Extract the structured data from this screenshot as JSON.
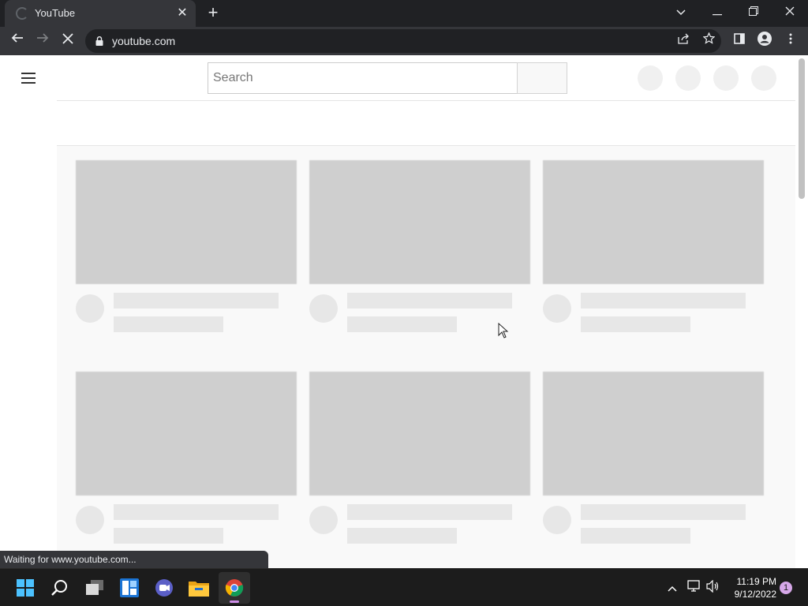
{
  "browser": {
    "tab_title": "YouTube",
    "url": "youtube.com",
    "status_text": "Waiting for www.youtube.com..."
  },
  "page": {
    "search_placeholder": "Search",
    "header_buttons": [
      "header-circle-1",
      "header-circle-2",
      "header-circle-3",
      "header-circle-4"
    ],
    "video_placeholders": [
      1,
      2,
      3,
      4,
      5,
      6
    ]
  },
  "taskbar": {
    "apps": [
      "start-icon",
      "search-icon",
      "task-view-icon",
      "widgets-icon",
      "teams-chat-icon",
      "file-explorer-icon",
      "chrome-icon"
    ],
    "time": "11:19 PM",
    "date": "9/12/2022",
    "notification_count": "1"
  },
  "colors": {
    "placeholder_gray": "#cfcfcf",
    "chrome_dark": "#202124",
    "chrome_toolbar": "#35363a"
  }
}
